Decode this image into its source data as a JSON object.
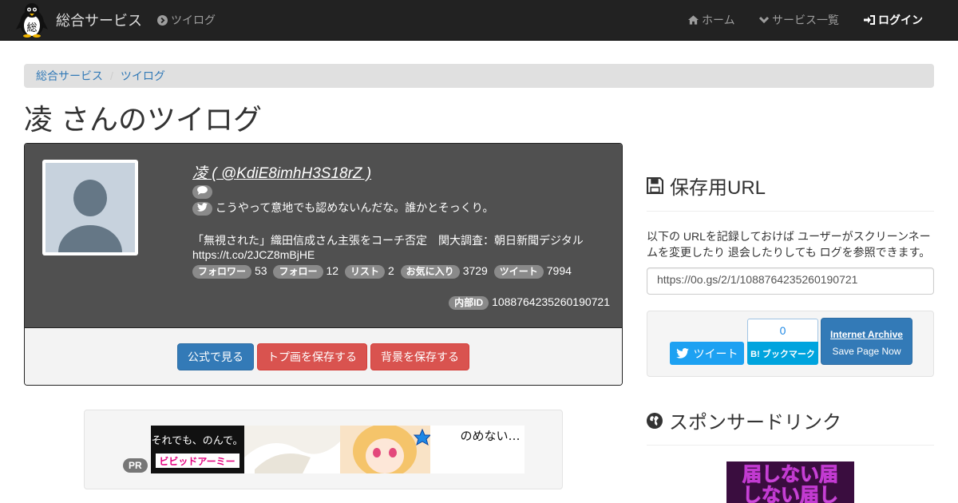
{
  "navbar": {
    "brand": "総合サービス",
    "brand_logo_char": "総",
    "left_link": "ツイログ",
    "right_links": [
      "ホーム",
      "サービス一覧",
      "ログイン"
    ]
  },
  "breadcrumb": [
    "総合サービス",
    "ツイログ"
  ],
  "page_title": "凌 さんのツイログ",
  "profile": {
    "name": "凌 ( @KdiE8imhH3S18rZ )",
    "bio": "こうやって意地でも認めないんだな。誰かとそっくり。",
    "quote": "「無視された」織田信成さん主張をコーチ否定　関大調査：朝日新聞デジタル",
    "url": "https://t.co/2JCZ8mBjHE",
    "stats": [
      {
        "label": "フォロワー",
        "value": "53"
      },
      {
        "label": "フォロー",
        "value": "12"
      },
      {
        "label": "リスト",
        "value": "2"
      },
      {
        "label": "お気に入り",
        "value": "3729"
      },
      {
        "label": "ツイート",
        "value": "7994"
      }
    ],
    "internal_id_label": "内部ID",
    "internal_id": "1088764235260190721"
  },
  "actions": {
    "official": "公式で見る",
    "save_top": "トプ画を保存する",
    "save_bg": "背景を保存する"
  },
  "pr": {
    "badge": "PR",
    "banner_left_top": "それでも、のんで。",
    "banner_left_bottom": "ビビッドアーミー",
    "banner_right": "のめない…"
  },
  "sidebar": {
    "save_heading": "保存用URL",
    "save_desc": "以下の URLを記録しておけば ユーザーがスクリーンネームを変更したり 退会したりしても ログを参照できます。",
    "save_url": "https://0o.gs/2/1/1088764235260190721",
    "tweet_btn": "ツイート",
    "hatena_count": "0",
    "hatena_btn": "B! ブックマーク",
    "ia_title": "Internet Archive",
    "ia_sub": "Save Page Now",
    "sponsor_heading": "スポンサードリンク",
    "sponsor_text_1": "届しない届",
    "sponsor_text_2": "しない届し"
  },
  "colors": {
    "navbar_bg": "#222222",
    "primary": "#337ab7",
    "danger": "#d9534f",
    "profile_bg": "#505050",
    "twitter": "#1da1f2",
    "hatena": "#00a4de"
  }
}
